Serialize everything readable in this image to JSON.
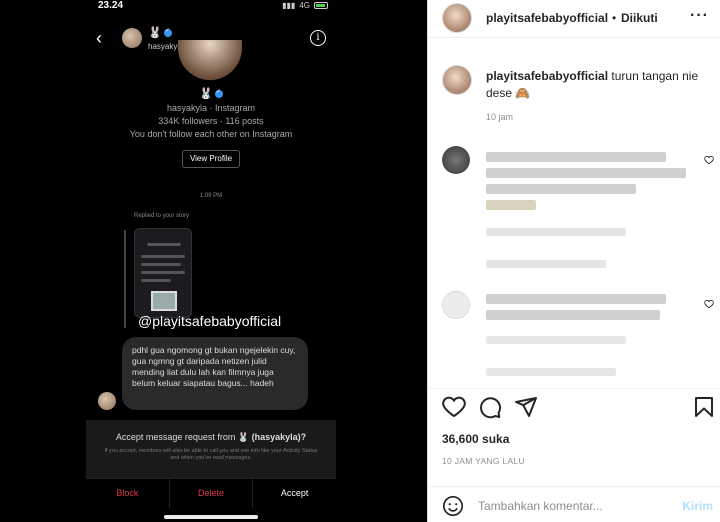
{
  "phone": {
    "status_time": "23.24",
    "status_network": "4G",
    "header_emoji": "🐰",
    "header_username": "hasyakyla",
    "profile_emoji": "🐰",
    "profile_line": "hasyakyla · Instagram",
    "profile_stats": "334K followers · 116 posts",
    "profile_follow": "You don't follow each other on Instagram",
    "view_profile": "View Profile",
    "message_time": "1:09 PM",
    "replied_label": "Replied to your story",
    "story_handle": "@playitsafebabyofficial",
    "message_text": "pdhl gua ngomong gt bukan ngejelekin cuy, gua ngmng gt daripada netizen julid mending liat dulu lah kan filmnya juga belum keluar siapatau bagus... hadeh",
    "request_title_prefix": "Accept message request from",
    "request_title_emoji": "🐰",
    "request_title_user": "(hasyakyla)?",
    "request_note": "If you accept, members will also be able to call you and see info like your Activity Status and when you've read messages.",
    "block": "Block",
    "delete": "Delete",
    "accept": "Accept"
  },
  "post": {
    "username": "playitsafebabyofficial",
    "dot": "•",
    "follow_status": "Diikuti",
    "caption_user": "playitsafebabyofficial",
    "caption_text": "turun tangan nie dese 🙈",
    "caption_time": "10 jam",
    "likes": "36,600 suka",
    "posted_ago": "10 JAM YANG LALU",
    "comment_placeholder": "Tambahkan komentar...",
    "post_button": "Kirim"
  },
  "icons": {
    "heart": "heart-icon",
    "comment": "comment-icon",
    "share": "share-icon",
    "save": "bookmark-icon",
    "emoji": "emoji-icon",
    "more": "more-options-icon"
  },
  "colors": {
    "verified": "#3897f0",
    "destructive": "#e0354a",
    "post_button_disabled": "#b2dffc"
  }
}
